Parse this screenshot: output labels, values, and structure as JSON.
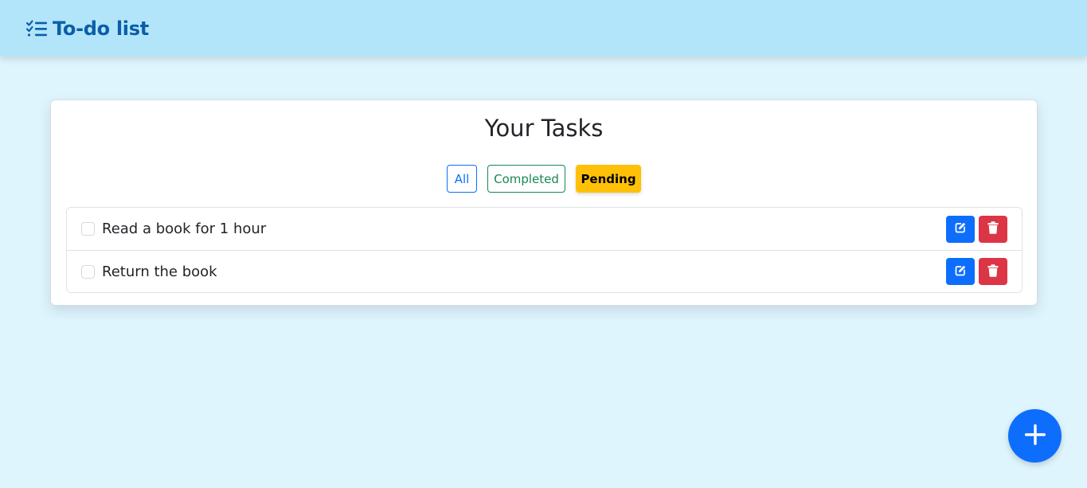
{
  "navbar": {
    "brand_icon": "list-check-icon",
    "brand_text": "To-do list"
  },
  "card": {
    "title": "Your Tasks",
    "filters": [
      {
        "label": "All",
        "state": "outline-primary"
      },
      {
        "label": "Completed",
        "state": "outline-success"
      },
      {
        "label": "Pending",
        "state": "active-warning"
      }
    ]
  },
  "tasks": [
    {
      "text": "Read a book for 1 hour",
      "completed": false
    },
    {
      "text": "Return the book",
      "completed": false
    }
  ],
  "actions": {
    "edit_icon": "pencil-square-icon",
    "delete_icon": "trash-icon"
  },
  "fab": {
    "icon": "plus-icon"
  },
  "colors": {
    "navbar_bg": "#b3e5fa",
    "page_bg": "#dff5fe",
    "brand": "#0b5ea8",
    "primary": "#0d6efd",
    "success": "#198754",
    "warning": "#ffc107",
    "danger": "#dc3545"
  }
}
